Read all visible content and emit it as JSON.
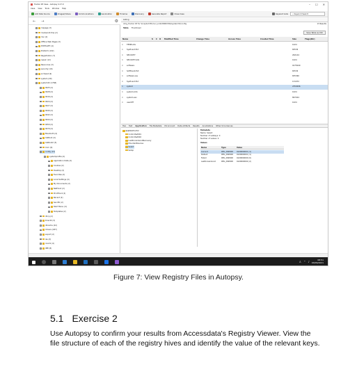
{
  "screenshot": {
    "window_title": "Hunter XP Case - Autopsy 4.17.0",
    "window_controls": [
      "–",
      "☐",
      "✕"
    ],
    "menu": [
      "Case",
      "View",
      "Tools",
      "Window",
      "Help"
    ],
    "toolbar": [
      "Add Data Source",
      "Images/Videos",
      "Communications",
      "Geolocation",
      "Timeline",
      "Discovery",
      "Generate Report",
      "Close Case"
    ],
    "keyword_lists": "Keyword Lists",
    "keyword_search": "Keyword Search",
    "tree_items": [
      {
        "label": "mappgs (3)",
        "indent": 1
      },
      {
        "label": "msdownld.tmp (2)",
        "indent": 1
      },
      {
        "label": "mui (2)",
        "indent": 1
      },
      {
        "label": "Offline Web Pages (3)",
        "indent": 1
      },
      {
        "label": "PCHEALTH (4)",
        "indent": 1
      },
      {
        "label": "Prefetch (102)",
        "indent": 1
      },
      {
        "label": "Registration (7)",
        "indent": 1
      },
      {
        "label": "repair (12)",
        "indent": 1
      },
      {
        "label": "Resources (3)",
        "indent": 1
      },
      {
        "label": "security (10)",
        "indent": 1
      },
      {
        "label": "srchasst (9)",
        "indent": 1
      },
      {
        "label": "system (29)",
        "indent": 1
      },
      {
        "label": "system32 (1768)",
        "indent": 1
      },
      {
        "label": "0025 (2)",
        "indent": 2
      },
      {
        "label": "0028 (2)",
        "indent": 2
      },
      {
        "label": "0016 (2)",
        "indent": 2
      },
      {
        "label": "0024 (2)",
        "indent": 2
      },
      {
        "label": "0027 (2)",
        "indent": 2
      },
      {
        "label": "0040 (2)",
        "indent": 2
      },
      {
        "label": "0042 (2)",
        "indent": 2
      },
      {
        "label": "0044 (2)",
        "indent": 2
      },
      {
        "label": "0050 (2)",
        "indent": 2
      },
      {
        "label": "0079 (2)",
        "indent": 2
      },
      {
        "label": "Bluetooth (4)",
        "indent": 2
      },
      {
        "label": "CatRoot (4)",
        "indent": 2
      },
      {
        "label": "CatRoot2 (5)",
        "indent": 2
      },
      {
        "label": "Com (9)",
        "indent": 2
      },
      {
        "label": "config (13)",
        "indent": 2,
        "selected": true
      },
      {
        "label": "systemprofile (4)",
        "indent": 3
      },
      {
        "label": "Application Data (4)",
        "indent": 4
      },
      {
        "label": "Cookies (2)",
        "indent": 4
      },
      {
        "label": "Desktop (2)",
        "indent": 4
      },
      {
        "label": "Favorites (2)",
        "indent": 4
      },
      {
        "label": "Local Settings (4)",
        "indent": 4
      },
      {
        "label": "My Documents (2)",
        "indent": 4
      },
      {
        "label": "NetHood (2)",
        "indent": 4
      },
      {
        "label": "PrintHood (2)",
        "indent": 4
      },
      {
        "label": "Recent (2)",
        "indent": 4
      },
      {
        "label": "SendTo (2)",
        "indent": 4
      },
      {
        "label": "Start Menu (4)",
        "indent": 4
      },
      {
        "label": "Templates (2)",
        "indent": 4
      },
      {
        "label": "dhcp (2)",
        "indent": 2
      },
      {
        "label": "DirectX (3)",
        "indent": 2
      },
      {
        "label": "dllcache (22)",
        "indent": 2
      },
      {
        "label": "drivers (187)",
        "indent": 2
      },
      {
        "label": "export (2)",
        "indent": 2
      },
      {
        "label": "ias (4)",
        "indent": 2
      },
      {
        "label": "icsxml (4)",
        "indent": 2
      },
      {
        "label": "IME (8)",
        "indent": 2
      }
    ],
    "listing": {
      "tab": "Listing",
      "path": "/img_Hunter XP for Scrapbot.E01/vol_vol2/WINDOWS/system32/config",
      "results": "13 Results",
      "subtabs": [
        "Table",
        "Thumbnail"
      ],
      "save_label": "Save Table as CSV",
      "columns": [
        "Name",
        "S",
        "C",
        "O",
        "Modified Time",
        "Change Time",
        "Access Time",
        "Created Time",
        "Size",
        "Flags(Dir)"
      ],
      "rows": [
        {
          "name": "TEMP.LOG",
          "size": "1024"
        },
        {
          "name": "SysEvent.Evt",
          "size": "65536"
        },
        {
          "name": "SECURITY",
          "size": "262144"
        },
        {
          "name": "SECURITY.LOG",
          "size": "1024"
        },
        {
          "name": "software",
          "size": "9175040"
        },
        {
          "name": "SoftEvent.Evt",
          "size": "65536"
        },
        {
          "name": "software.sav",
          "size": "655360"
        },
        {
          "name": "SysEvent.Evt",
          "size": "131072"
        },
        {
          "name": "system",
          "size": "2359296",
          "selected": true
        },
        {
          "name": "system.LOG",
          "size": "1024"
        },
        {
          "name": "system.sav",
          "size": "897024"
        },
        {
          "name": "userdiff",
          "size": "1024"
        }
      ]
    },
    "detail_tabs": [
      "Hex",
      "Text",
      "Application",
      "File Metadata",
      "OS Account",
      "Data Artifacts",
      "Results",
      "Annotations",
      "Other Occurrences"
    ],
    "hive_tree": [
      "$$$PROTO.HIV",
      "ControlSet001",
      "ControlSet002",
      "LastKnownGoodRecovery",
      "MountedDevices",
      "Select",
      "Setup"
    ],
    "metadata": {
      "heading": "Metadata",
      "lines": [
        "Name: Select",
        "Number of subkeys: 0",
        "Number of values: 4"
      ],
      "values_heading": "Values",
      "value_columns": [
        "Name",
        "Type",
        "Value"
      ],
      "values": [
        {
          "name": "Current",
          "type": "REG_DWORD",
          "value": "0x00000001 (1)"
        },
        {
          "name": "Default",
          "type": "REG_DWORD",
          "value": "0x00000001 (1)"
        },
        {
          "name": "Failed",
          "type": "REG_DWORD",
          "value": "0x00000000 (0)"
        },
        {
          "name": "LastKnownGood",
          "type": "REG_DWORD",
          "value": "0x00000002 (2)"
        }
      ]
    },
    "clock_time": "08:51",
    "clock_date": "03/06/2021"
  },
  "document": {
    "caption": "Figure 7: View Registry Files in Autopsy.",
    "section_number": "5.1",
    "section_title": "Exercise 2",
    "paragraph": "Use Autopsy to confirm your results from Accessdata's Registry Viewer. View the file structure of each of the registry hives and identify the value of the relevant keys."
  }
}
